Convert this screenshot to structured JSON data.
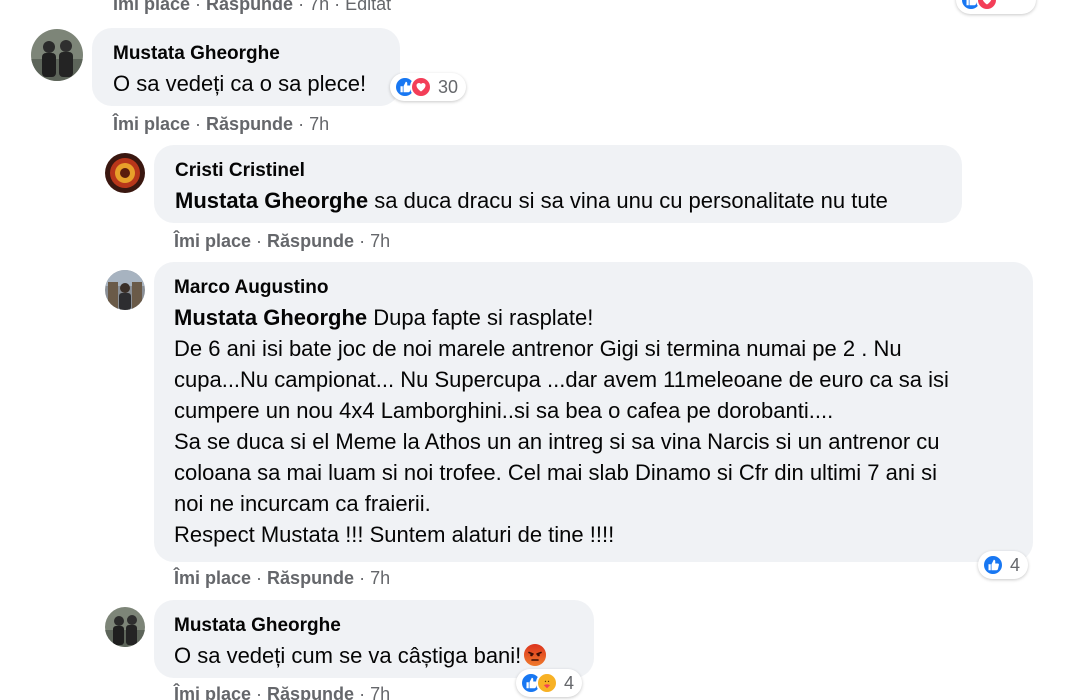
{
  "top_actions": {
    "like": "Îmi place",
    "reply": "Răspunde",
    "time": "7h",
    "edited": "Editat"
  },
  "comments": [
    {
      "author": "Mustata Gheorghe",
      "text": "O sa vedeți ca o sa plece!",
      "reactions": {
        "icons": [
          "like-icon",
          "love-icon"
        ],
        "count": "30"
      },
      "actions": {
        "like": "Îmi place",
        "reply": "Răspunde",
        "time": "7h"
      }
    },
    {
      "author": "Cristi Cristinel",
      "tag": "Mustata Gheorghe",
      "text": " sa duca dracu si sa vina unu cu personalitate nu tute",
      "actions": {
        "like": "Îmi place",
        "reply": "Răspunde",
        "time": "7h"
      }
    },
    {
      "author": "Marco Augustino",
      "tag": "Mustata Gheorghe",
      "text": " Dupa fapte si rasplate!",
      "lines": [
        "De 6 ani isi bate joc de noi marele antrenor Gigi si termina numai pe 2 . Nu",
        "cupa...Nu campionat... Nu Supercupa ...dar avem 11meleoane de euro ca sa isi",
        "cumpere un nou 4x4 Lamborghini..si sa bea o cafea pe dorobanti....",
        "Sa se duca si el Meme la Athos un an intreg si sa vina Narcis si un antrenor cu",
        "coloana sa mai luam si noi trofee. Cel mai slab Dinamo si Cfr din ultimi 7 ani si",
        "noi ne incurcam ca fraierii.",
        "Respect Mustata !!! Suntem alaturi de tine !!!!"
      ],
      "reactions": {
        "icons": [
          "like-icon"
        ],
        "count": "4"
      },
      "actions": {
        "like": "Îmi place",
        "reply": "Răspunde",
        "time": "7h"
      }
    },
    {
      "author": "Mustata Gheorghe",
      "text": "O sa vedeți cum se va câștiga bani!",
      "inline_emoji": "angry-face-emoji",
      "reactions": {
        "icons": [
          "like-icon",
          "care-icon"
        ],
        "count": "4"
      },
      "actions": {
        "like": "Îmi place",
        "reply": "Răspunde",
        "time": "7h"
      }
    }
  ],
  "colors": {
    "bubble": "#f0f2f5",
    "meta_text": "#65676b",
    "like_blue": "#1877f2",
    "love_red": "#f33e58",
    "angry_orange": "#e9710f"
  }
}
